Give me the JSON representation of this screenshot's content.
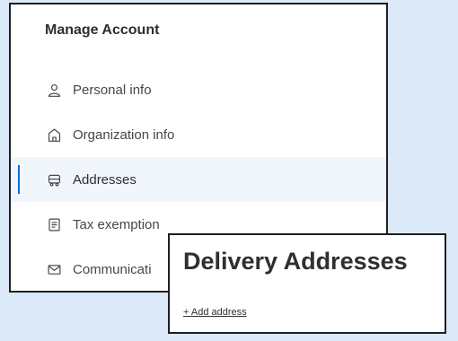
{
  "manage_account": {
    "title": "Manage Account",
    "menu": [
      {
        "label": "Personal info",
        "icon": "person-icon",
        "active": false
      },
      {
        "label": "Organization info",
        "icon": "building-icon",
        "active": false
      },
      {
        "label": "Addresses",
        "icon": "truck-icon",
        "active": true
      },
      {
        "label": "Tax exemption",
        "icon": "document-icon",
        "active": false
      },
      {
        "label": "Communicati",
        "icon": "mail-icon",
        "active": false
      }
    ]
  },
  "delivery": {
    "title": "Delivery Addresses",
    "add_link": "+ Add address"
  },
  "colors": {
    "background": "#dbe9f8",
    "active_accent": "#0071dc",
    "active_bg": "#f1f6fd",
    "text": "#2e2f32"
  }
}
